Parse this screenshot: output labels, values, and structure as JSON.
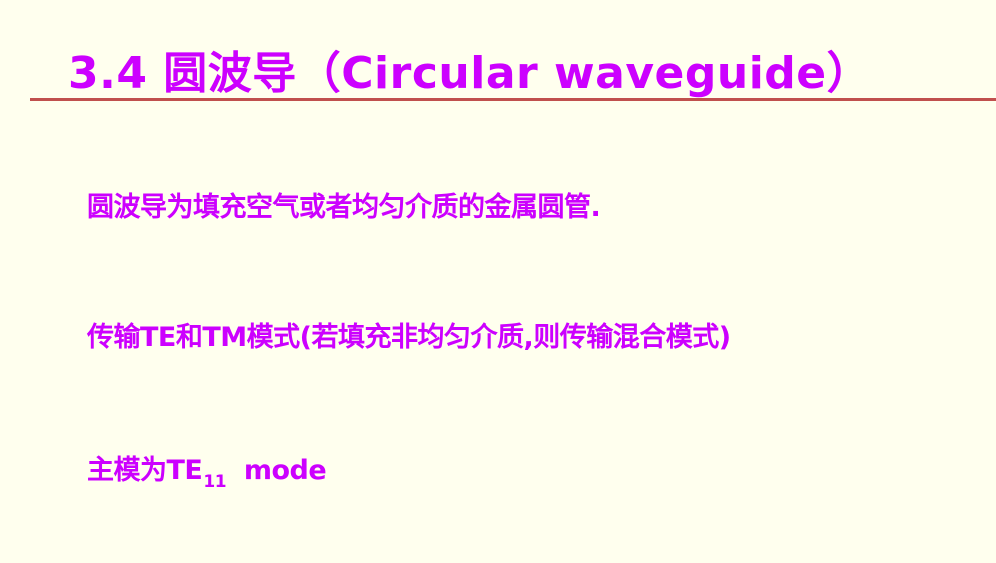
{
  "colors": {
    "background": "#FFFFEE",
    "text": "#CC00FF",
    "rule": "#C0504D"
  },
  "slide": {
    "title": "3.4 圆波导（Circular waveguide）",
    "bullets": [
      "圆波导为填充空气或者均匀介质的金属圆管.",
      "传输TE和TM模式(若填充非均匀介质,则传输混合模式)",
      {
        "prefix": "主模为TE",
        "subscript": "11",
        "suffix": "mode"
      }
    ]
  }
}
